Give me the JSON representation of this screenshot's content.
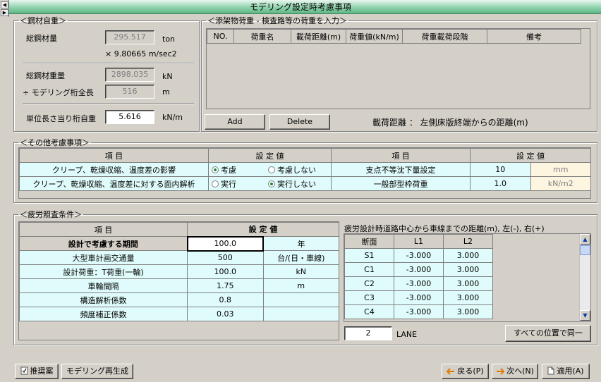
{
  "window": {
    "title": "モデリング設定時考慮事項"
  },
  "steel": {
    "legend": "＜鋼材自重＞",
    "total_label": "総鋼材量",
    "total_value": "295.517",
    "total_unit": "ton",
    "gravity_text": "× 9.80665 m/sec2",
    "weight_label": "総鋼材重量",
    "weight_value": "2898.035",
    "weight_unit": "kN",
    "length_label": "÷ モデリング桁全長",
    "length_value": "516",
    "length_unit": "m",
    "unit_label": "単位長さ当り桁自重",
    "unit_value": "5.616",
    "unit_unit": "kN/m"
  },
  "attached": {
    "legend": "＜添架物荷重 - 検査路等の荷重を入力＞",
    "columns": [
      "NO.",
      "荷重名",
      "載荷距離(m)",
      "荷重値(kN/m)",
      "荷重載荷段階",
      "備考"
    ],
    "add_label": "Add",
    "delete_label": "Delete",
    "note": "載荷距離 ： 左側床版終端からの距離(m)"
  },
  "other": {
    "legend": "＜その他考慮事項＞",
    "h_item": "項 目",
    "h_value": "設 定 値",
    "rows": [
      {
        "item": "クリープ、乾燥収縮、温度差の影響",
        "opt1": "考慮",
        "opt2": "考慮しない"
      },
      {
        "item": "クリープ、乾燥収縮、温度差に対する面内解析",
        "opt1": "実行",
        "opt2": "実行しない"
      }
    ],
    "right_rows": [
      {
        "item": "支点不等沈下量設定",
        "value": "10",
        "unit": "mm"
      },
      {
        "item": "一般部型枠荷重",
        "value": "1.0",
        "unit": "kN/m2"
      }
    ]
  },
  "fatigue": {
    "legend": "＜疲労照査条件＞",
    "h_item": "項 目",
    "h_value": "設 定 値",
    "rows": [
      {
        "item": "設計で考慮する期間",
        "value": "100.0",
        "unit": "年"
      },
      {
        "item": "大型車計画交通量",
        "value": "500",
        "unit": "台/(日・車線)"
      },
      {
        "item": "設計荷重：T荷重(一輪)",
        "value": "100.0",
        "unit": "kN"
      },
      {
        "item": "車輪間隔",
        "value": "1.75",
        "unit": "m"
      },
      {
        "item": "構造解析係数",
        "value": "0.8",
        "unit": ""
      },
      {
        "item": "頻度補正係数",
        "value": "0.03",
        "unit": ""
      }
    ],
    "dist_title": "疲労設計時道路中心から車線までの距離(m), 左(-), 右(+)",
    "dist_columns": [
      "断面",
      "L1",
      "L2"
    ],
    "dist_rows": [
      {
        "name": "S1",
        "l1": "-3.000",
        "l2": "3.000"
      },
      {
        "name": "C1",
        "l1": "-3.000",
        "l2": "3.000"
      },
      {
        "name": "C2",
        "l1": "-3.000",
        "l2": "3.000"
      },
      {
        "name": "C3",
        "l1": "-3.000",
        "l2": "3.000"
      },
      {
        "name": "C4",
        "l1": "-3.000",
        "l2": "3.000"
      }
    ],
    "lane_value": "2",
    "lane_label": "LANE",
    "same_all_label": "すべての位置で同一"
  },
  "footer": {
    "recommend_label": "推奨案",
    "regenerate_label": "モデリング再生成",
    "back_label": "戻る(P)",
    "next_label": "次へ(N)",
    "apply_label": "適用(A)"
  }
}
